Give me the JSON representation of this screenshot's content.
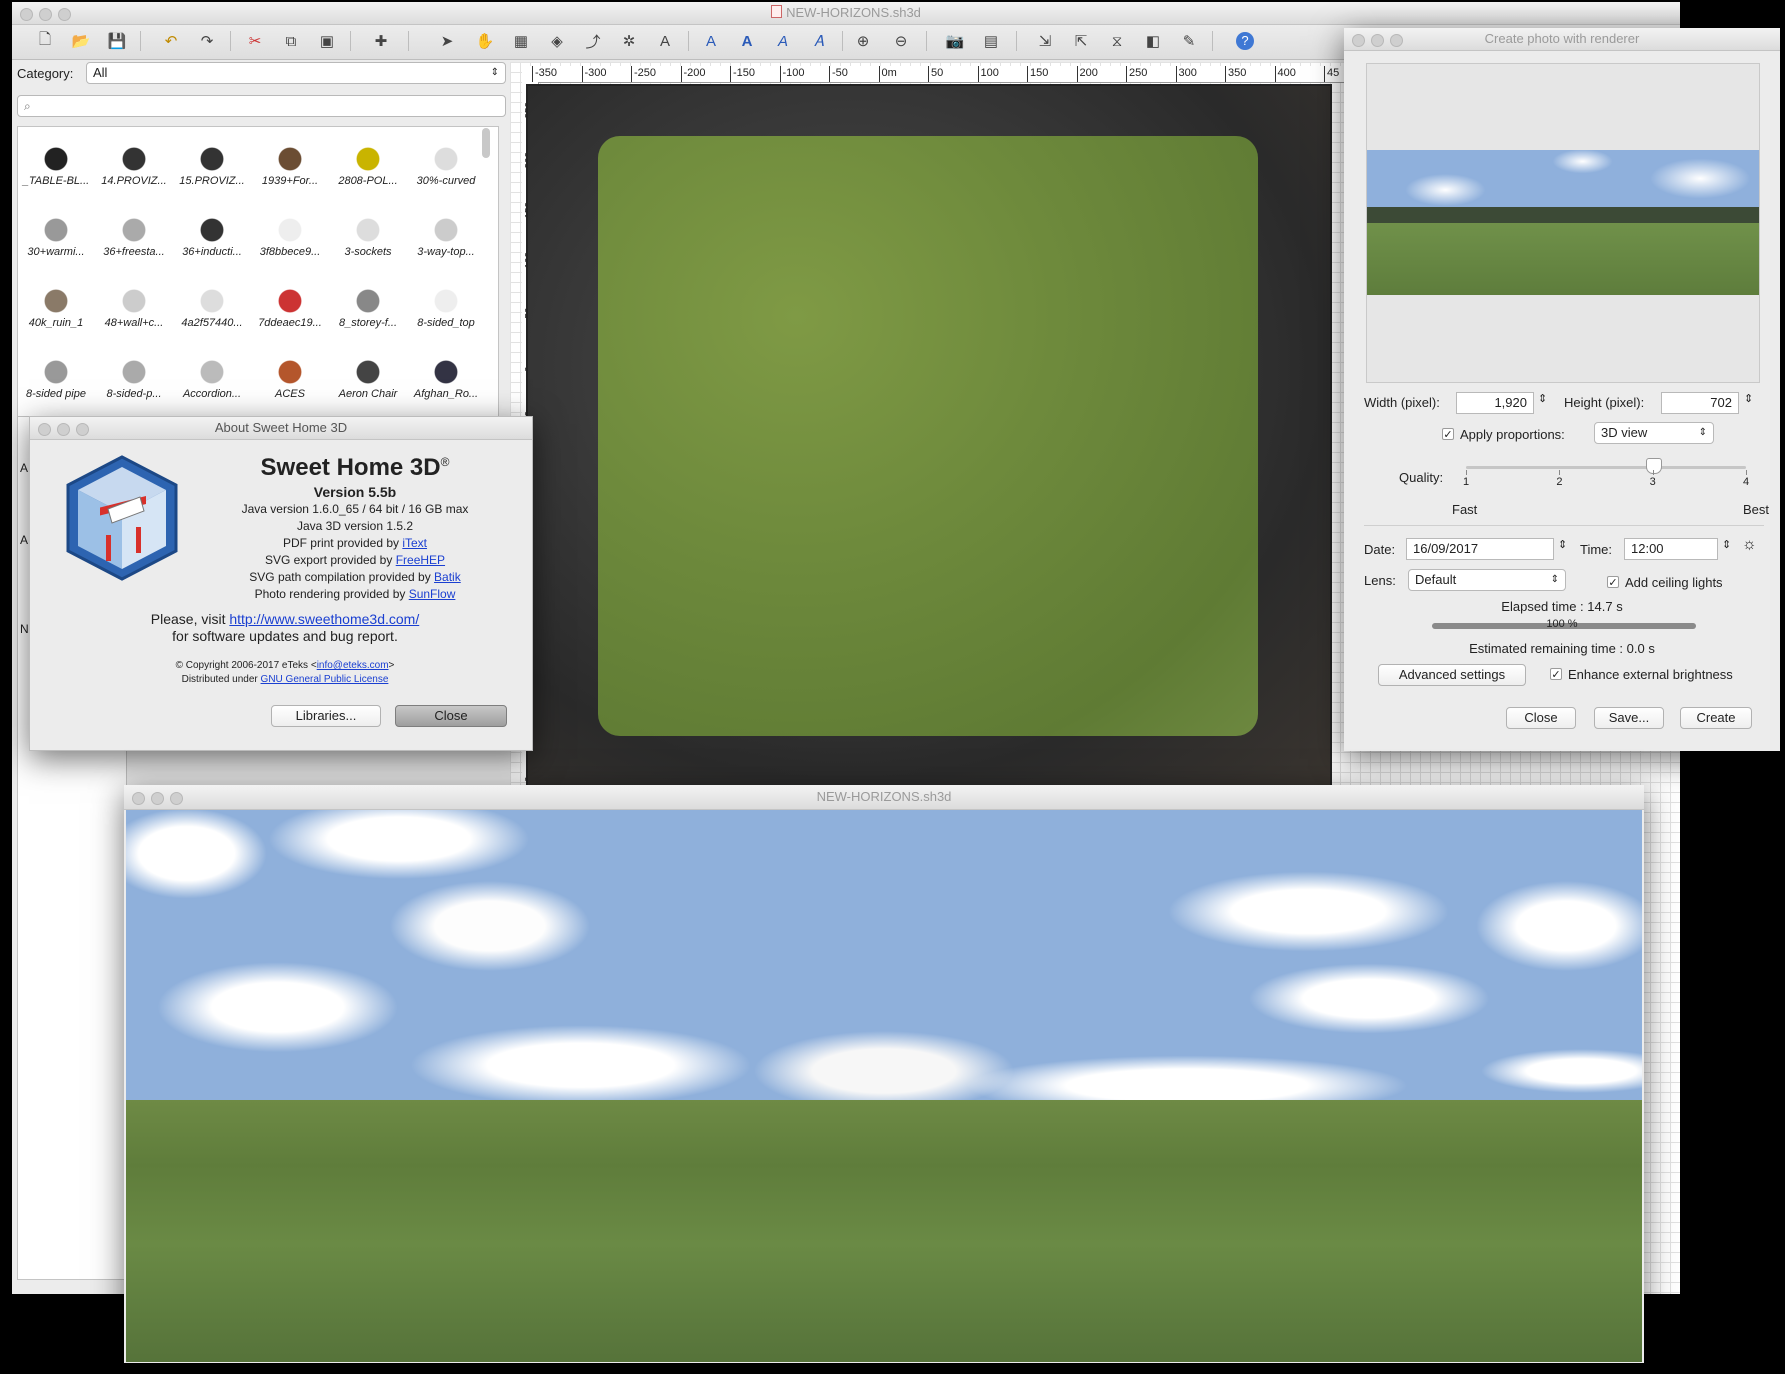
{
  "main_window": {
    "title": "NEW-HORIZONS.sh3d",
    "category_label": "Category:",
    "category_value": "All",
    "search_placeholder": "",
    "catalog": [
      {
        "name": "_TABLE-BL...",
        "icon": "table-icon"
      },
      {
        "name": "14.PROVIZ...",
        "icon": "chair-icon"
      },
      {
        "name": "15.PROVIZ...",
        "icon": "chair-icon"
      },
      {
        "name": "1939+For...",
        "icon": "car-icon"
      },
      {
        "name": "2808-POL...",
        "icon": "hydrant-icon"
      },
      {
        "name": "30%-curved",
        "icon": "panel-icon"
      },
      {
        "name": "30+warmi...",
        "icon": "drawer-icon"
      },
      {
        "name": "36+freesta...",
        "icon": "fridge-icon"
      },
      {
        "name": "36+inducti...",
        "icon": "cooktop-icon"
      },
      {
        "name": "3f8bbece9...",
        "icon": "hat-icon"
      },
      {
        "name": "3-sockets",
        "icon": "socket-icon"
      },
      {
        "name": "3-way-top...",
        "icon": "sink-icon"
      },
      {
        "name": "40k_ruin_1",
        "icon": "ruin-icon"
      },
      {
        "name": "48+wall+c...",
        "icon": "wallcabinet-icon"
      },
      {
        "name": "4a2f57440...",
        "icon": "lamp-icon"
      },
      {
        "name": "7ddeaec19...",
        "icon": "carousel-icon"
      },
      {
        "name": "8_storey-f...",
        "icon": "building-icon"
      },
      {
        "name": "8-sided_top",
        "icon": "top-icon"
      },
      {
        "name": "8-sided pipe",
        "icon": "pipe-icon"
      },
      {
        "name": "8-sided-p...",
        "icon": "pole-icon"
      },
      {
        "name": "Accordion...",
        "icon": "accordion-door-icon"
      },
      {
        "name": "ACES",
        "icon": "person-icon"
      },
      {
        "name": "Aeron Chair",
        "icon": "office-chair-icon"
      },
      {
        "name": "Afghan_Ro...",
        "icon": "robot-icon"
      }
    ],
    "ruler_h": [
      "-350",
      "-300",
      "-250",
      "-200",
      "-150",
      "-100",
      "-50",
      "0m",
      "50",
      "100",
      "150",
      "200",
      "250",
      "300",
      "350",
      "400",
      "45"
    ],
    "ruler_v": [
      "-250",
      "-200",
      "-150",
      "-100",
      "-50",
      "0m",
      "50",
      "0"
    ],
    "left_stub_labels": [
      "A",
      "A",
      "N"
    ]
  },
  "about": {
    "window_title": "About Sweet Home 3D",
    "app_name": "Sweet Home 3D",
    "reg": "®",
    "version": "Version 5.5b",
    "java": "Java version 1.6.0_65 / 64 bit / 16 GB max",
    "java3d": "Java 3D version 1.5.2",
    "pdf_prefix": "PDF print provided by ",
    "pdf_link": "iText",
    "svg_prefix": "SVG export provided by ",
    "svg_link": "FreeHEP",
    "svgpath_prefix": "SVG path compilation provided by ",
    "svgpath_link": "Batik",
    "photo_prefix": "Photo rendering provided by ",
    "photo_link": "SunFlow",
    "visit_prefix": "Please, visit ",
    "visit_link": "http://www.sweethome3d.com/",
    "visit_suffix": "for software updates and bug report.",
    "copyright_prefix": "© Copyright 2006-2017 eTeks <",
    "copyright_link": "info@eteks.com",
    "copyright_suffix": ">",
    "license_prefix": "Distributed under ",
    "license_link": "GNU General Public License",
    "libraries_button": "Libraries...",
    "close_button": "Close"
  },
  "photo": {
    "window_title": "Create photo with renderer",
    "width_label": "Width (pixel):",
    "width_value": "1,920",
    "height_label": "Height (pixel):",
    "height_value": "702",
    "apply_proportions_label": "Apply proportions:",
    "apply_proportions_checked": "✓",
    "proportions_value": "3D view",
    "quality_label": "Quality:",
    "quality_ticks": [
      "1",
      "2",
      "3",
      "4"
    ],
    "quality_value": 3,
    "quality_fast": "Fast",
    "quality_best": "Best",
    "date_label": "Date:",
    "date_value": "16/09/2017",
    "time_label": "Time:",
    "time_value": "12:00",
    "lens_label": "Lens:",
    "lens_value": "Default",
    "ceiling_lights_label": "Add ceiling lights",
    "ceiling_lights_checked": "✓",
    "elapsed": "Elapsed time : 14.7 s",
    "progress_label": "100 %",
    "progress": 1.0,
    "remaining": "Estimated remaining time : 0.0 s",
    "advanced_button": "Advanced settings",
    "enhance_label": "Enhance external brightness",
    "enhance_checked": "✓",
    "close_button": "Close",
    "save_button": "Save...",
    "create_button": "Create"
  },
  "view3d": {
    "window_title": "NEW-HORIZONS.sh3d"
  }
}
